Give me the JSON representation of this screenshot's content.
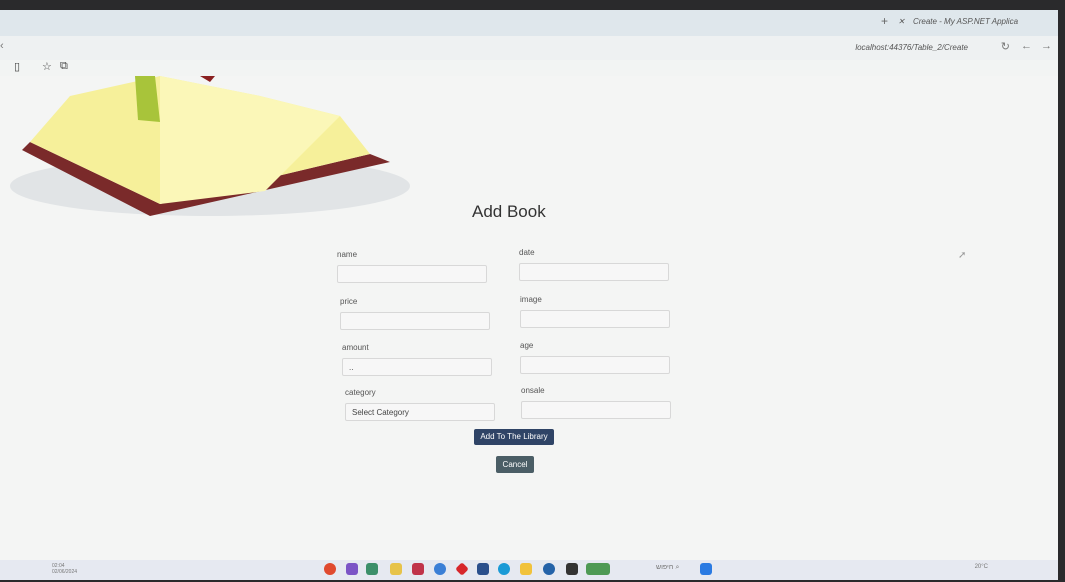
{
  "browser": {
    "tab_title": "Create - My ASP.NET Applica",
    "url": "localhost:44376/Table_2/Create"
  },
  "page": {
    "title": "Add Book",
    "fields": {
      "name": "name",
      "date": "date",
      "price": "price",
      "image": "image",
      "amount": "amount",
      "age": "age",
      "category": "category",
      "onsale": "onsale"
    },
    "category_selected": "Select Category",
    "amount_value": "..",
    "add_button": "Add To The Library",
    "cancel_button": "Cancel"
  },
  "taskbar": {
    "clock_time": "02:04",
    "clock_date": "02/06/2024",
    "search_label": "חיפוש",
    "tray_weather": "20°C"
  },
  "colors": {
    "primary_button": "#2f4466",
    "secondary_button": "#4b5e66",
    "background": "#f4f5f4"
  }
}
